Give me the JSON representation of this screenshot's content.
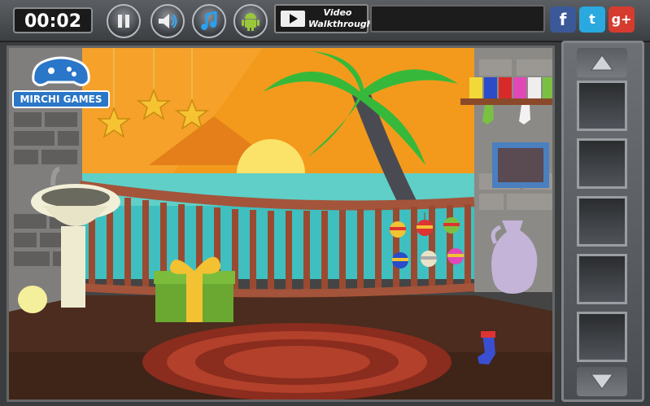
{
  "header": {
    "timer": "00:02",
    "walkthrough": {
      "line1": "Video",
      "line2": "Walkthrough"
    },
    "buttons": [
      {
        "name": "pause-button",
        "icon": "pause-icon"
      },
      {
        "name": "sound-button",
        "icon": "speaker-icon"
      },
      {
        "name": "music-button",
        "icon": "music-note-icon"
      },
      {
        "name": "android-button",
        "icon": "android-icon"
      }
    ],
    "social": [
      {
        "name": "facebook-button",
        "label": "f",
        "color": "#3b5998"
      },
      {
        "name": "twitter-button",
        "label": "t",
        "color": "#2aa9e0"
      },
      {
        "name": "googleplus-button",
        "label": "g+",
        "color": "#d63b2f"
      }
    ]
  },
  "logo": {
    "text": "MIRCHI GAMES"
  },
  "inventory": {
    "slots": 5
  }
}
